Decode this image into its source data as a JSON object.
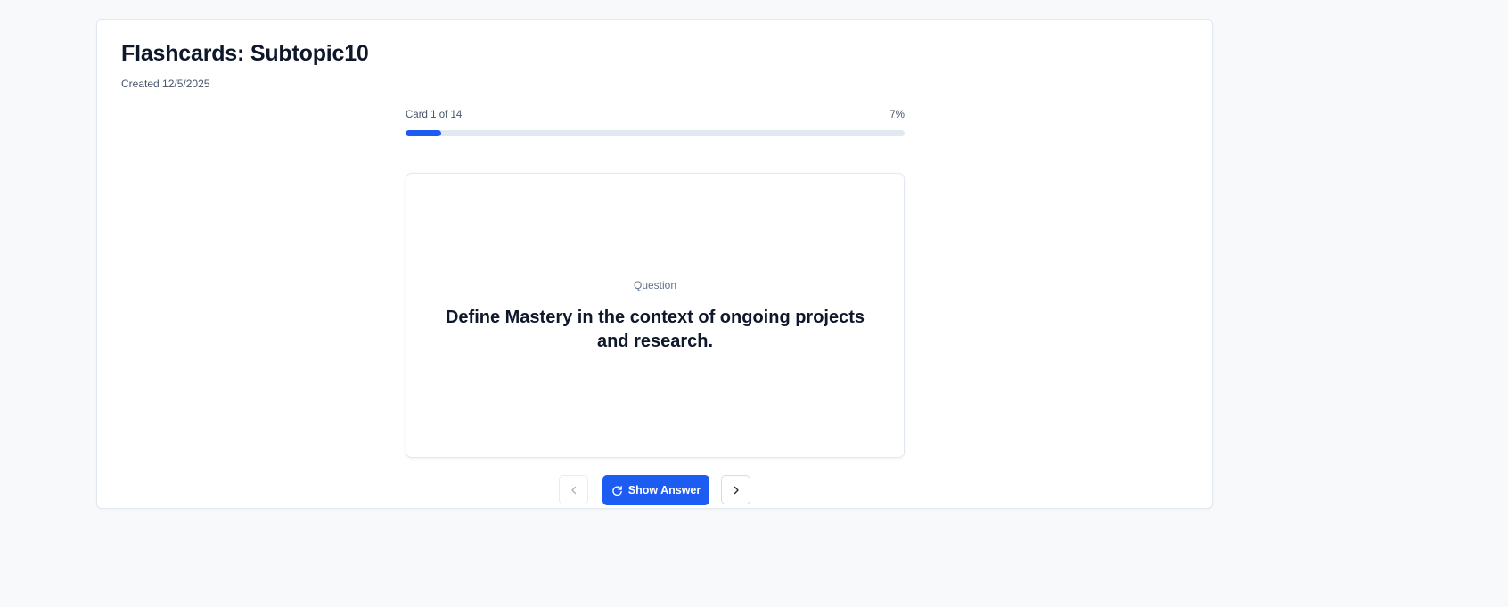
{
  "header": {
    "title": "Flashcards: Subtopic10",
    "created": "Created 12/5/2025"
  },
  "progress": {
    "label": "Card 1 of 14",
    "percent_text": "7%",
    "fraction": 0.071
  },
  "card": {
    "kind": "Question",
    "text": "Define Mastery in the context of ongoing projects and research."
  },
  "controls": {
    "show_answer_label": "Show Answer",
    "previous_icon": "chevron-left-icon",
    "next_icon": "chevron-right-icon",
    "show_answer_icon": "refresh-icon"
  },
  "colors": {
    "accent": "#1d5cf2",
    "track": "#e2e8f0",
    "page_background": "#f8f9fb",
    "heading": "#0f172a",
    "muted_text": "#475569"
  }
}
